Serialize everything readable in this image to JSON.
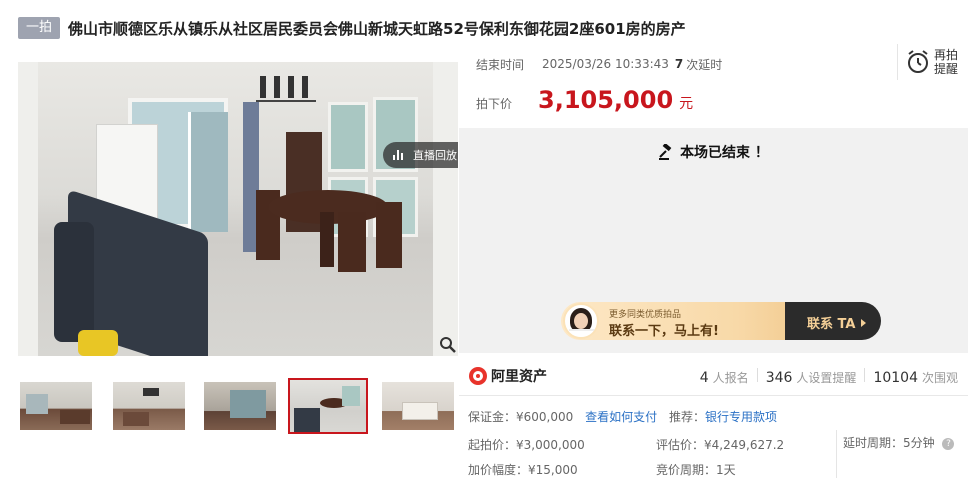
{
  "header": {
    "badge": "一拍",
    "title": "佛山市顺德区乐从镇乐从社区居民委员会佛山新城天虹路52号保利东御花园2座601房的房产"
  },
  "gallery": {
    "replay_label": "直播回放",
    "replay_arrow": "›",
    "active_thumb_index": 3
  },
  "auction": {
    "end_label": "结束时间",
    "end_time": "2025/03/26 10:33:43",
    "delay_count": "7",
    "delay_suffix": "次延时",
    "remind_label_line1": "再拍",
    "remind_label_line2": "提醒",
    "price_label": "拍下价",
    "price_value": "3,105,000",
    "price_unit": "元",
    "ended_text": "本场已结束 ！"
  },
  "contact_banner": {
    "subtitle": "更多同类优质拍品",
    "main_text": "联系一下，马上有!",
    "button_label": "联系 TA"
  },
  "stats": {
    "brand": "阿里资产",
    "signups_count": "4",
    "signups_label": "人报名",
    "reminders_count": "346",
    "reminders_label": "人设置提醒",
    "views_count": "10104",
    "views_label": "次围观"
  },
  "details": {
    "deposit_label": "保证金：",
    "deposit_value": "¥600,000",
    "pay_link": "查看如何支付",
    "recommend_label": "推荐：",
    "recommend_link": "银行专用款项",
    "start_price_label": "起拍价：",
    "start_price_value": "¥3,000,000",
    "appraisal_label": "评估价：",
    "appraisal_value": "¥4,249,627.2",
    "delay_period_label": "延时周期：",
    "delay_period_value": "5分钟",
    "increment_label": "加价幅度：",
    "increment_value": "¥15,000",
    "bid_period_label": "竞价周期：",
    "bid_period_value": "1天"
  },
  "colors": {
    "price_red": "#c8161d",
    "link_blue": "#2b71c5",
    "badge_gray": "#9ea3b0",
    "panel_gray": "#f1f1f1",
    "banner_gold": "#f4cf97"
  }
}
